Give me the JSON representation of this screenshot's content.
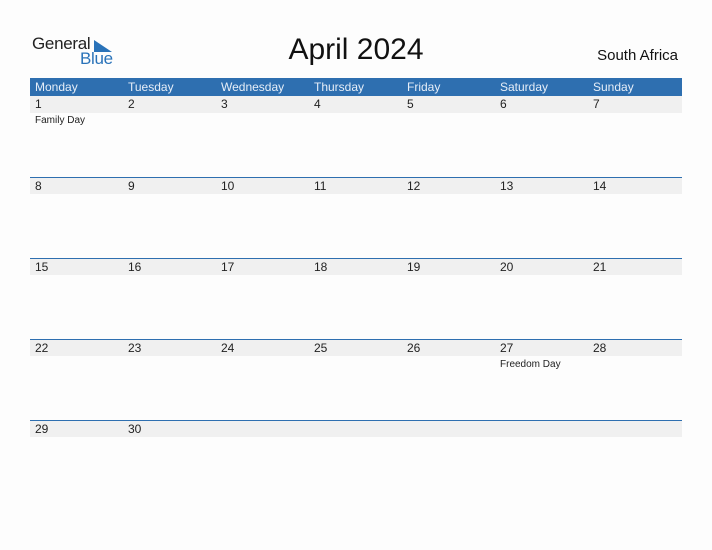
{
  "logo": {
    "line1": "General",
    "line2": "Blue",
    "accent": "#2a73b9"
  },
  "title": "April 2024",
  "country": "South Africa",
  "colors": {
    "header_bg": "#2e6fb0",
    "date_strip": "#f0f0f0"
  },
  "weekdays": [
    "Monday",
    "Tuesday",
    "Wednesday",
    "Thursday",
    "Friday",
    "Saturday",
    "Sunday"
  ],
  "weeks": [
    [
      {
        "day": "1",
        "event": "Family Day"
      },
      {
        "day": "2",
        "event": ""
      },
      {
        "day": "3",
        "event": ""
      },
      {
        "day": "4",
        "event": ""
      },
      {
        "day": "5",
        "event": ""
      },
      {
        "day": "6",
        "event": ""
      },
      {
        "day": "7",
        "event": ""
      }
    ],
    [
      {
        "day": "8",
        "event": ""
      },
      {
        "day": "9",
        "event": ""
      },
      {
        "day": "10",
        "event": ""
      },
      {
        "day": "11",
        "event": ""
      },
      {
        "day": "12",
        "event": ""
      },
      {
        "day": "13",
        "event": ""
      },
      {
        "day": "14",
        "event": ""
      }
    ],
    [
      {
        "day": "15",
        "event": ""
      },
      {
        "day": "16",
        "event": ""
      },
      {
        "day": "17",
        "event": ""
      },
      {
        "day": "18",
        "event": ""
      },
      {
        "day": "19",
        "event": ""
      },
      {
        "day": "20",
        "event": ""
      },
      {
        "day": "21",
        "event": ""
      }
    ],
    [
      {
        "day": "22",
        "event": ""
      },
      {
        "day": "23",
        "event": ""
      },
      {
        "day": "24",
        "event": ""
      },
      {
        "day": "25",
        "event": ""
      },
      {
        "day": "26",
        "event": ""
      },
      {
        "day": "27",
        "event": "Freedom Day"
      },
      {
        "day": "28",
        "event": ""
      }
    ],
    [
      {
        "day": "29",
        "event": ""
      },
      {
        "day": "30",
        "event": ""
      },
      {
        "day": "",
        "event": ""
      },
      {
        "day": "",
        "event": ""
      },
      {
        "day": "",
        "event": ""
      },
      {
        "day": "",
        "event": ""
      },
      {
        "day": "",
        "event": ""
      }
    ]
  ]
}
